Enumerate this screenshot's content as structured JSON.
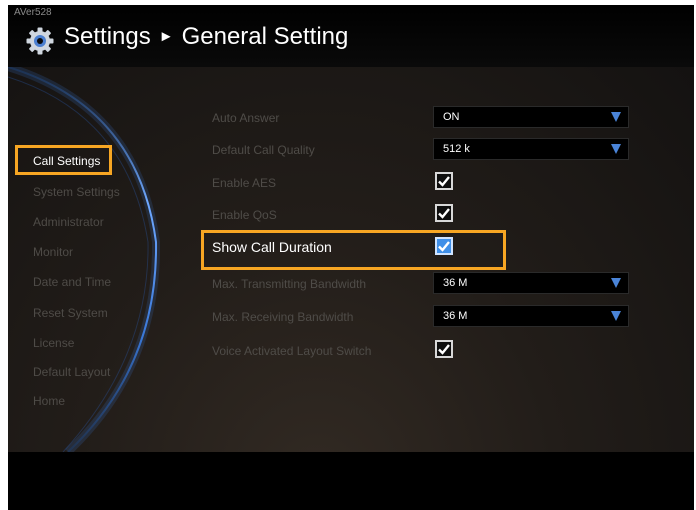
{
  "header": {
    "device_name": "AVer528",
    "title": "Settings",
    "subtitle": "General Setting",
    "separator": "►"
  },
  "sidebar": {
    "items": [
      {
        "label": "Call Settings",
        "active": true
      },
      {
        "label": "System Settings",
        "active": false
      },
      {
        "label": "Administrator",
        "active": false
      },
      {
        "label": "Monitor",
        "active": false
      },
      {
        "label": "Date and Time",
        "active": false
      },
      {
        "label": "Reset System",
        "active": false
      },
      {
        "label": "License",
        "active": false
      },
      {
        "label": "Default Layout",
        "active": false
      },
      {
        "label": "Home",
        "active": false
      }
    ]
  },
  "settings": {
    "rows": [
      {
        "label": "Auto Answer",
        "type": "select",
        "value": "ON"
      },
      {
        "label": "Default Call Quality",
        "type": "select",
        "value": "512 k"
      },
      {
        "label": "Enable AES",
        "type": "checkbox",
        "checked": true
      },
      {
        "label": "Enable QoS",
        "type": "checkbox",
        "checked": true
      },
      {
        "label": "Show Call Duration",
        "type": "checkbox",
        "checked": true,
        "focused": true
      },
      {
        "label": "Max. Transmitting Bandwidth",
        "type": "select",
        "value": "36 M"
      },
      {
        "label": "Max. Receiving Bandwidth",
        "type": "select",
        "value": "36 M"
      },
      {
        "label": "Voice Activated Layout Switch",
        "type": "checkbox",
        "checked": true
      }
    ]
  },
  "colors": {
    "highlight": "#f7a623",
    "caret": "#4a84d8",
    "focus_checkbox": "#3f8fe8"
  },
  "icons": {
    "gear": "gear-icon",
    "caret": "caret-down-icon",
    "check": "checkmark-icon"
  }
}
